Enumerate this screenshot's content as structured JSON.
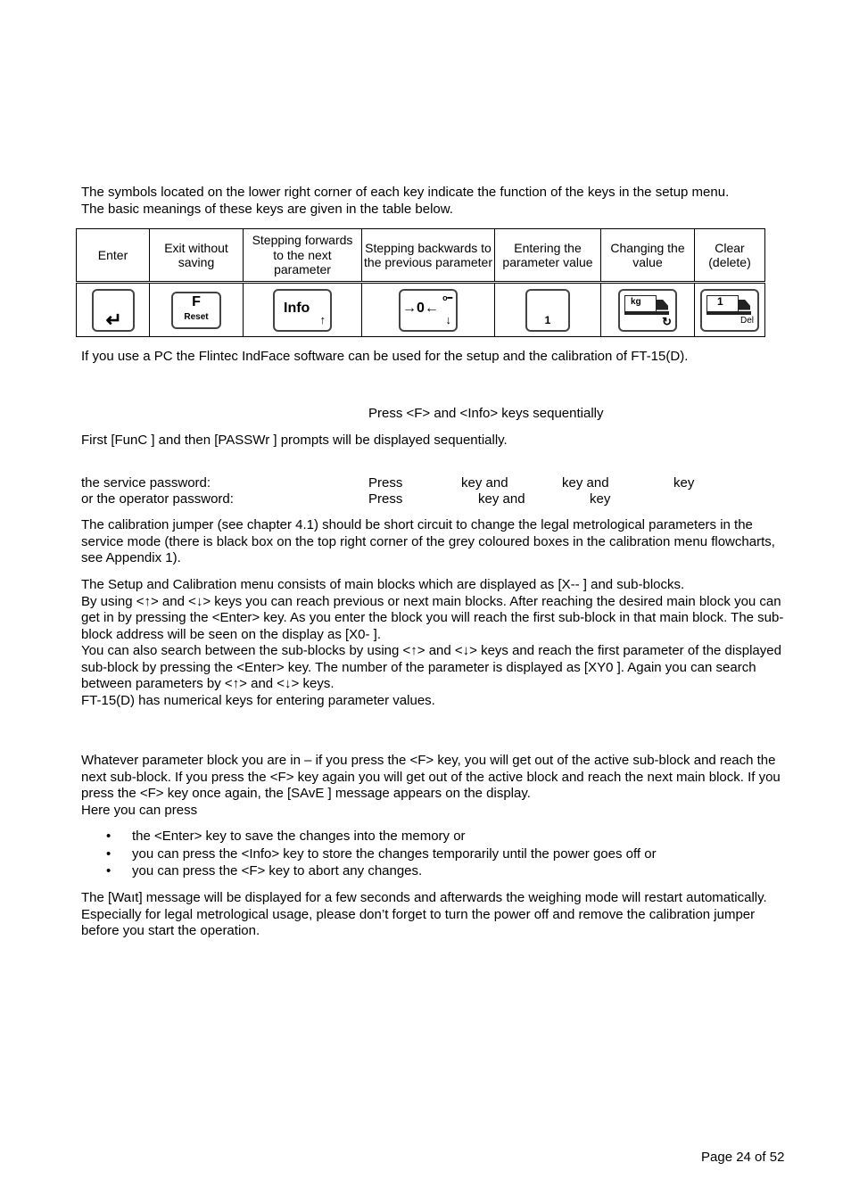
{
  "intro": {
    "line1": "The symbols located on the lower right corner of each key indicate the function of the keys in the setup menu.",
    "line2": "The basic meanings of these keys are given in the table below."
  },
  "key_table": {
    "headers": [
      "Enter",
      "Exit without saving",
      "Stepping forwards to the next parameter",
      "Stepping backwards to the previous parameter",
      "Entering the parameter value",
      "Changing the value",
      "Clear (delete)"
    ],
    "icons": [
      {
        "name": "enter-key-icon",
        "label": "↵"
      },
      {
        "name": "f-reset-key-icon",
        "label": "F",
        "sub": "Reset"
      },
      {
        "name": "info-key-icon",
        "label": "Info",
        "sub": "↑"
      },
      {
        "name": "zero-key-icon",
        "label": "→0←",
        "sub": "↓",
        "corner": "o━"
      },
      {
        "name": "numeric-one-key-icon",
        "label": "1"
      },
      {
        "name": "truck-kg-key-icon",
        "label": "kg",
        "sub": "↻"
      },
      {
        "name": "truck-one-del-key-icon",
        "label": "1",
        "sub": "Del"
      }
    ]
  },
  "pc_note": "If you use a PC the Flintec IndFace software can be used for the setup and the calibration of FT-15(D).",
  "press_f_info": "Press <F> and <Info> keys sequentially",
  "prompts": "First [FunC  ] and then [PASSWr ] prompts will be displayed sequentially.",
  "passwords": {
    "service_label": "the service password:",
    "service_press": "Press",
    "service_key_and_1": "key and",
    "service_key_and_2": "key and",
    "service_key": "key",
    "operator_label": "or the operator password:",
    "operator_press": "Press",
    "operator_key_and": "key and",
    "operator_key": "key"
  },
  "jumper_para": "The calibration jumper (see chapter 4.1) should be short circuit to change the legal metrological parameters in the service mode (there is black box on the top right corner of the grey coloured boxes in the calibration menu flowcharts, see Appendix 1).",
  "menu_para": [
    "The Setup and Calibration menu consists of main blocks which are displayed as [X--     ]  and sub-blocks.",
    "By using <↑> and <↓>  keys you can reach previous or next main blocks. After reaching the desired main block you can get in by pressing the <Enter> key. As you enter the block you will reach the first sub-block in that main block. The sub-block address will be seen on the display as [X0-     ].",
    "You can also search between the sub-blocks by using <↑> and <↓> keys and reach the first parameter of the displayed sub-block by pressing the <Enter> key. The number of the parameter is displayed as [XY0     ]. Again you can search between parameters by <↑> and <↓> keys.",
    "FT-15(D) has numerical keys for entering parameter values."
  ],
  "exit_para": "Whatever parameter block you are in – if you press the <F> key, you will get out of the active sub-block and reach the next sub-block. If you press the <F> key again you will get out of the active block and reach the next main block. If you press the <F> key once again, the [SAvE ] message appears on the display.",
  "here_press": "Here you can press",
  "bullets": [
    "the <Enter> key to save the changes into the memory or",
    "you can press the <Info> key to store the changes temporarily until the power goes off or",
    "you can press the <F> key to abort any changes."
  ],
  "wait_para": "The [Waıt] message will be displayed for a few seconds and afterwards the weighing mode will restart automatically. Especially for legal metrological usage, please don’t forget to turn the power off and remove the calibration jumper before you start the operation.",
  "footer": "Page 24 of 52"
}
